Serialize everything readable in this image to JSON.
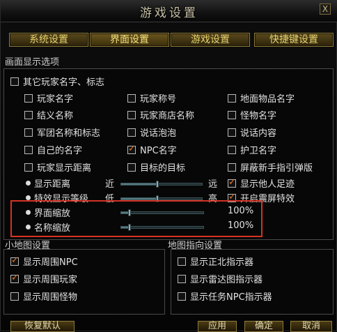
{
  "window": {
    "title": "游戏设置",
    "close": "X"
  },
  "tabs": [
    "系统设置",
    "界面设置",
    "游戏设置",
    "快捷键设置"
  ],
  "display_section": {
    "label": "画面显示选项"
  },
  "other_player_names": {
    "label": "其它玩家名字、标志",
    "checked": false
  },
  "options": [
    {
      "label": "玩家名字",
      "checked": false
    },
    {
      "label": "玩家称号",
      "checked": false
    },
    {
      "label": "地面物品名字",
      "checked": false
    },
    {
      "label": "结义名称",
      "checked": false
    },
    {
      "label": "玩家商店名称",
      "checked": false
    },
    {
      "label": "怪物名字",
      "checked": false
    },
    {
      "label": "军团名称和标志",
      "checked": false
    },
    {
      "label": "说话泡泡",
      "checked": false
    },
    {
      "label": "说话内容",
      "checked": false
    },
    {
      "label": "自己的名字",
      "checked": false
    },
    {
      "label": "NPC名字",
      "checked": true
    },
    {
      "label": "护卫名字",
      "checked": false
    },
    {
      "label": "玩家显示距离",
      "checked": false
    },
    {
      "label": "目标的目标",
      "checked": false
    },
    {
      "label": "屏蔽新手指引弹版",
      "checked": false
    }
  ],
  "sliders": {
    "distance": {
      "label": "显示距离",
      "min_label": "近",
      "max_label": "远",
      "value": 0.45
    },
    "effects": {
      "label": "特效显示等级",
      "min_label": "低",
      "max_label": "高",
      "value": 0.45
    },
    "ui_scale": {
      "label": "界面缩放",
      "value_text": "100%",
      "value": 0.1
    },
    "name_scale": {
      "label": "名称缩放",
      "value_text": "100%",
      "value": 0.1
    }
  },
  "right_checks": [
    {
      "label": "显示他人足迹",
      "checked": true
    },
    {
      "label": "开启震屏特效",
      "checked": true
    }
  ],
  "minimap": {
    "label": "小地图设置",
    "items": [
      {
        "label": "显示周围NPC",
        "checked": true
      },
      {
        "label": "显示周围玩家",
        "checked": true
      },
      {
        "label": "显示周围怪物",
        "checked": false
      }
    ]
  },
  "map_pointer": {
    "label": "地图指向设置",
    "items": [
      {
        "label": "显示正北指示器",
        "checked": false
      },
      {
        "label": "显示雷达图指示器",
        "checked": false
      },
      {
        "label": "显示任务NPC指示器",
        "checked": false
      }
    ]
  },
  "buttons": {
    "reset": "恢复默认",
    "apply": "应用",
    "ok": "确定",
    "cancel": "取消"
  },
  "colors": {
    "highlight_frame": "#d43324",
    "tab_text": "#e8d36e",
    "check": "#e8762c"
  }
}
